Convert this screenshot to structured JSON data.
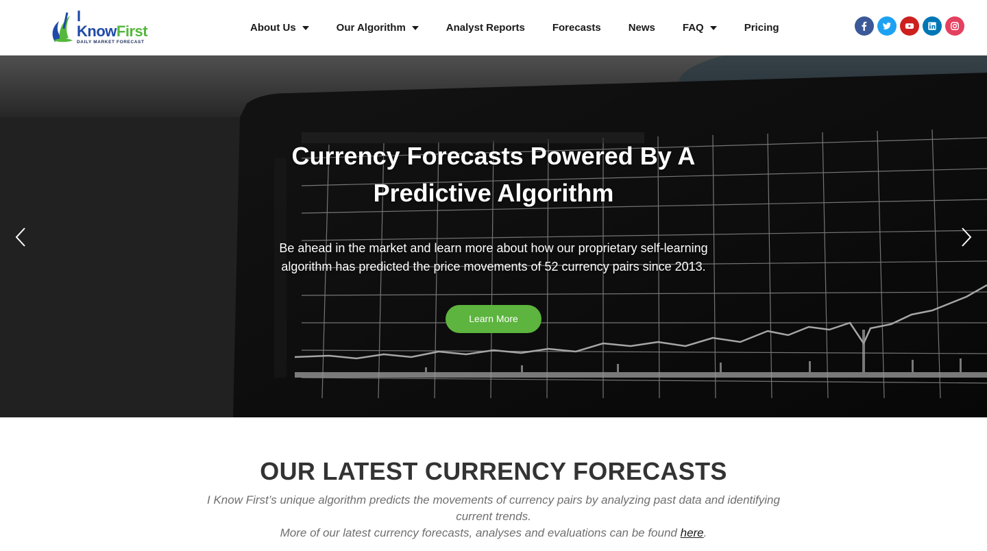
{
  "brand": {
    "name_part1": "I Know",
    "name_part2": "First",
    "tagline": "Daily Market Forecast"
  },
  "nav": {
    "items": [
      {
        "label": "About Us",
        "has_dropdown": true
      },
      {
        "label": "Our Algorithm",
        "has_dropdown": true
      },
      {
        "label": "Analyst Reports",
        "has_dropdown": false
      },
      {
        "label": "Forecasts",
        "has_dropdown": false
      },
      {
        "label": "News",
        "has_dropdown": false
      },
      {
        "label": "FAQ",
        "has_dropdown": true
      },
      {
        "label": "Pricing",
        "has_dropdown": false
      }
    ]
  },
  "socials": [
    {
      "icon": "facebook-icon",
      "color": "#3b5998"
    },
    {
      "icon": "twitter-icon",
      "color": "#1da1f2"
    },
    {
      "icon": "youtube-icon",
      "color": "#cd201f"
    },
    {
      "icon": "linkedin-icon",
      "color": "#0077b5"
    },
    {
      "icon": "instagram-icon",
      "color": "#e4405f"
    }
  ],
  "hero": {
    "title_line1": "Currency Forecasts Powered By A",
    "title_line2": "Predictive Algorithm",
    "description": "Be ahead in the market and learn more about how our proprietary self-learning algorithm has predicted the price movements of 52 currency pairs since 2013.",
    "button_label": "Learn More",
    "button_color": "#5db43e",
    "prev_icon": "chevron-left-icon",
    "next_icon": "chevron-right-icon"
  },
  "section": {
    "title": "OUR LATEST CURRENCY FORECASTS",
    "text_line1": "I Know First’s unique algorithm predicts the movements of currency pairs by analyzing past data and identifying current trends.",
    "text_line2_prefix": "More of our latest currency forecasts, analyses and evaluations can be found ",
    "text_link": "here",
    "text_line2_suffix": "."
  }
}
